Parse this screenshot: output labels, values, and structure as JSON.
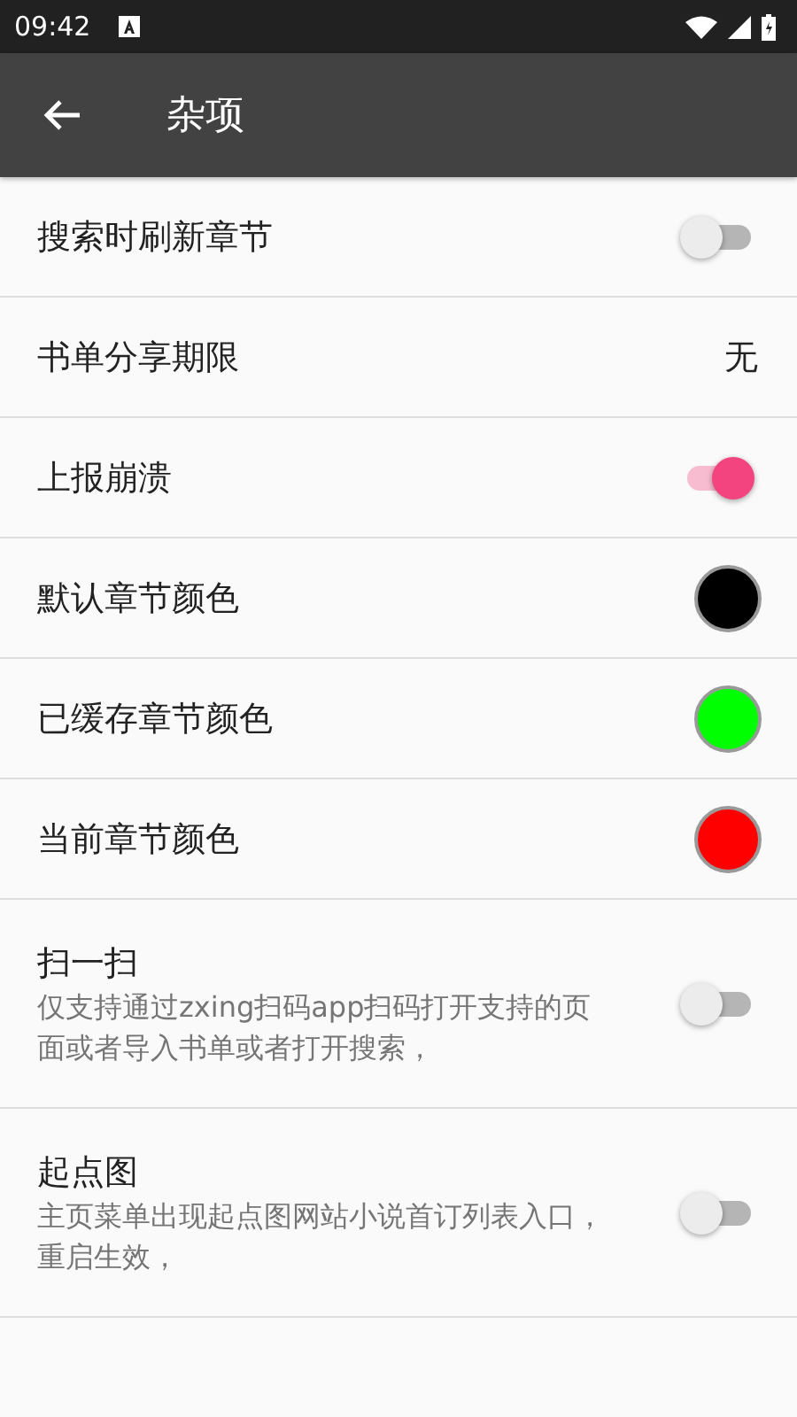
{
  "status_bar": {
    "time": "09:42"
  },
  "toolbar": {
    "title": "杂项"
  },
  "settings": [
    {
      "kind": "switch",
      "title": "搜索时刷新章节",
      "on": false
    },
    {
      "kind": "value",
      "title": "书单分享期限",
      "value": "无"
    },
    {
      "kind": "switch",
      "title": "上报崩溃",
      "on": true
    },
    {
      "kind": "color",
      "title": "默认章节颜色",
      "color": "#000000"
    },
    {
      "kind": "color",
      "title": "已缓存章节颜色",
      "color": "#00ff00"
    },
    {
      "kind": "color",
      "title": "当前章节颜色",
      "color": "#ff0000"
    },
    {
      "kind": "switch",
      "title": "扫一扫",
      "summary": "仅支持通过zxing扫码app扫码打开支持的页面或者导入书单或者打开搜索，",
      "on": false
    },
    {
      "kind": "switch",
      "title": "起点图",
      "summary": "主页菜单出现起点图网站小说首订列表入口，重启生效，",
      "on": false
    }
  ]
}
